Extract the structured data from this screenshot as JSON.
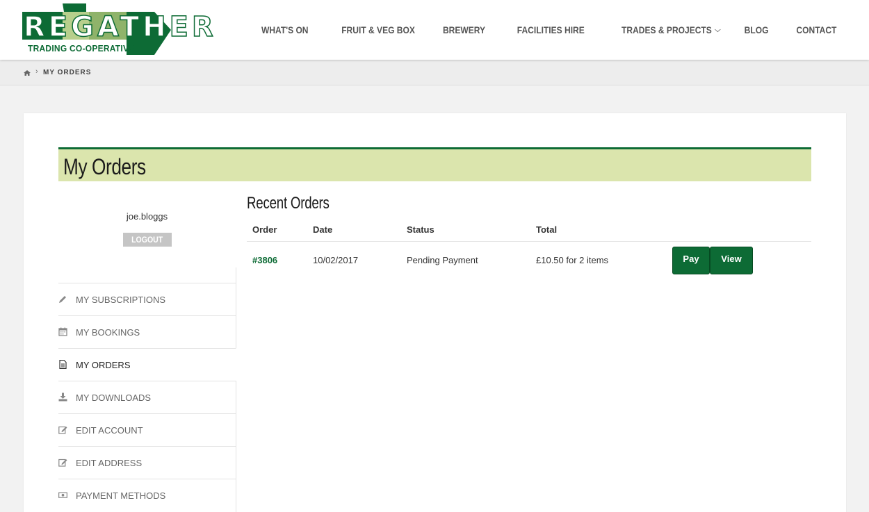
{
  "brand": {
    "logo_word": "REGATHER",
    "logo_subtitle": "TRADING CO-OPERATIVE",
    "primary_color": "#0d6b35",
    "light_green": "#8fb36a",
    "title_bar_color": "#dbe5ad"
  },
  "nav": {
    "items": [
      {
        "label": "WHAT'S ON"
      },
      {
        "label": "FRUIT & VEG BOX"
      },
      {
        "label": "BREWERY"
      },
      {
        "label": "FACILITIES HIRE"
      },
      {
        "label": "TRADES & PROJECTS",
        "has_dropdown": true
      },
      {
        "label": "BLOG"
      },
      {
        "label": "CONTACT"
      }
    ]
  },
  "breadcrumb": {
    "home_icon": "home-icon",
    "separator": "›",
    "current": "MY ORDERS"
  },
  "page": {
    "title": "My Orders"
  },
  "account": {
    "username": "joe.bloggs",
    "logout_label": "LOGOUT"
  },
  "menu": {
    "items": [
      {
        "label": "MY SUBSCRIPTIONS",
        "icon": "pencil-icon"
      },
      {
        "label": "MY BOOKINGS",
        "icon": "calendar-icon"
      },
      {
        "label": "MY ORDERS",
        "icon": "document-icon",
        "active": true
      },
      {
        "label": "MY DOWNLOADS",
        "icon": "download-icon"
      },
      {
        "label": "EDIT ACCOUNT",
        "icon": "edit-icon"
      },
      {
        "label": "EDIT ADDRESS",
        "icon": "edit-icon"
      },
      {
        "label": "PAYMENT METHODS",
        "icon": "money-icon"
      }
    ]
  },
  "orders": {
    "heading": "Recent Orders",
    "columns": [
      "Order",
      "Date",
      "Status",
      "Total"
    ],
    "rows": [
      {
        "order": "#3806",
        "date": "10/02/2017",
        "status": "Pending Payment",
        "total": "£10.50 for 2 items",
        "actions": [
          "Pay",
          "View"
        ]
      }
    ]
  }
}
